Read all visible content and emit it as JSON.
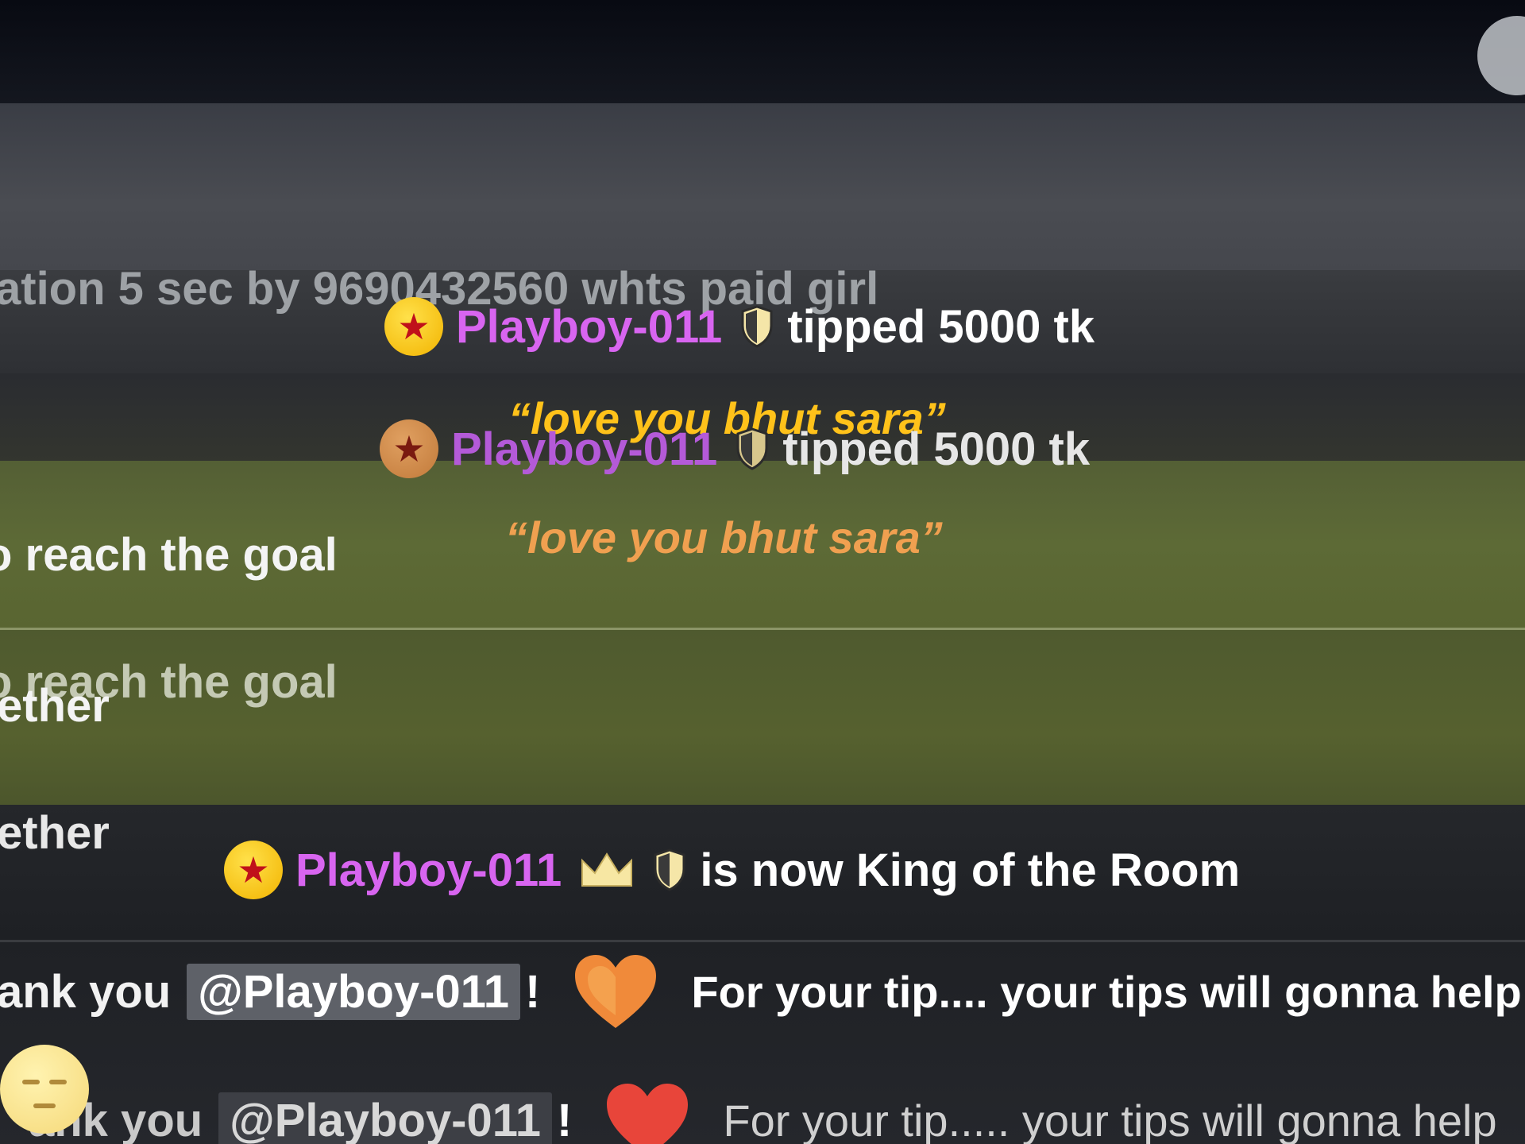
{
  "background_fragments": {
    "top_line": "ation 5 sec by 9690432560 whts paid girl",
    "goal_line_1": "o reach the goal",
    "goal_line_2": "o reach the goal",
    "ether_1": "ether",
    "ether_2": "ether"
  },
  "tip_events": [
    {
      "username": "Playboy-011",
      "message": "tipped 5000 tk",
      "quote": "“love you bhut sara”"
    },
    {
      "username": "Playboy-011",
      "message": "tipped 5000 tk",
      "quote": "“love you bhut sara”"
    }
  ],
  "king_event": {
    "username": "Playboy-011",
    "message": "is now King of the Room"
  },
  "thank_messages": [
    {
      "prefix": "ank you",
      "mention": "@Playboy-011",
      "excl": "!",
      "text": "For your tip.... your tips will gonna help"
    },
    {
      "prefix": "ank you",
      "mention": "@Playboy-011",
      "excl": "!",
      "text": "For your tip..... your tips will gonna help"
    }
  ],
  "icons": {
    "badge": "star-badge-icon",
    "shield": "shield-icon",
    "crown": "crown-icon",
    "heart": "heart-icon",
    "emoji": "neutral-face-emoji-icon"
  },
  "colors": {
    "username": "#d865f0",
    "quote": "#ffc21a",
    "badge": "#f2b300",
    "star": "#c0101a",
    "heart": "#e8453a",
    "goal_band": "#5d6a36"
  }
}
